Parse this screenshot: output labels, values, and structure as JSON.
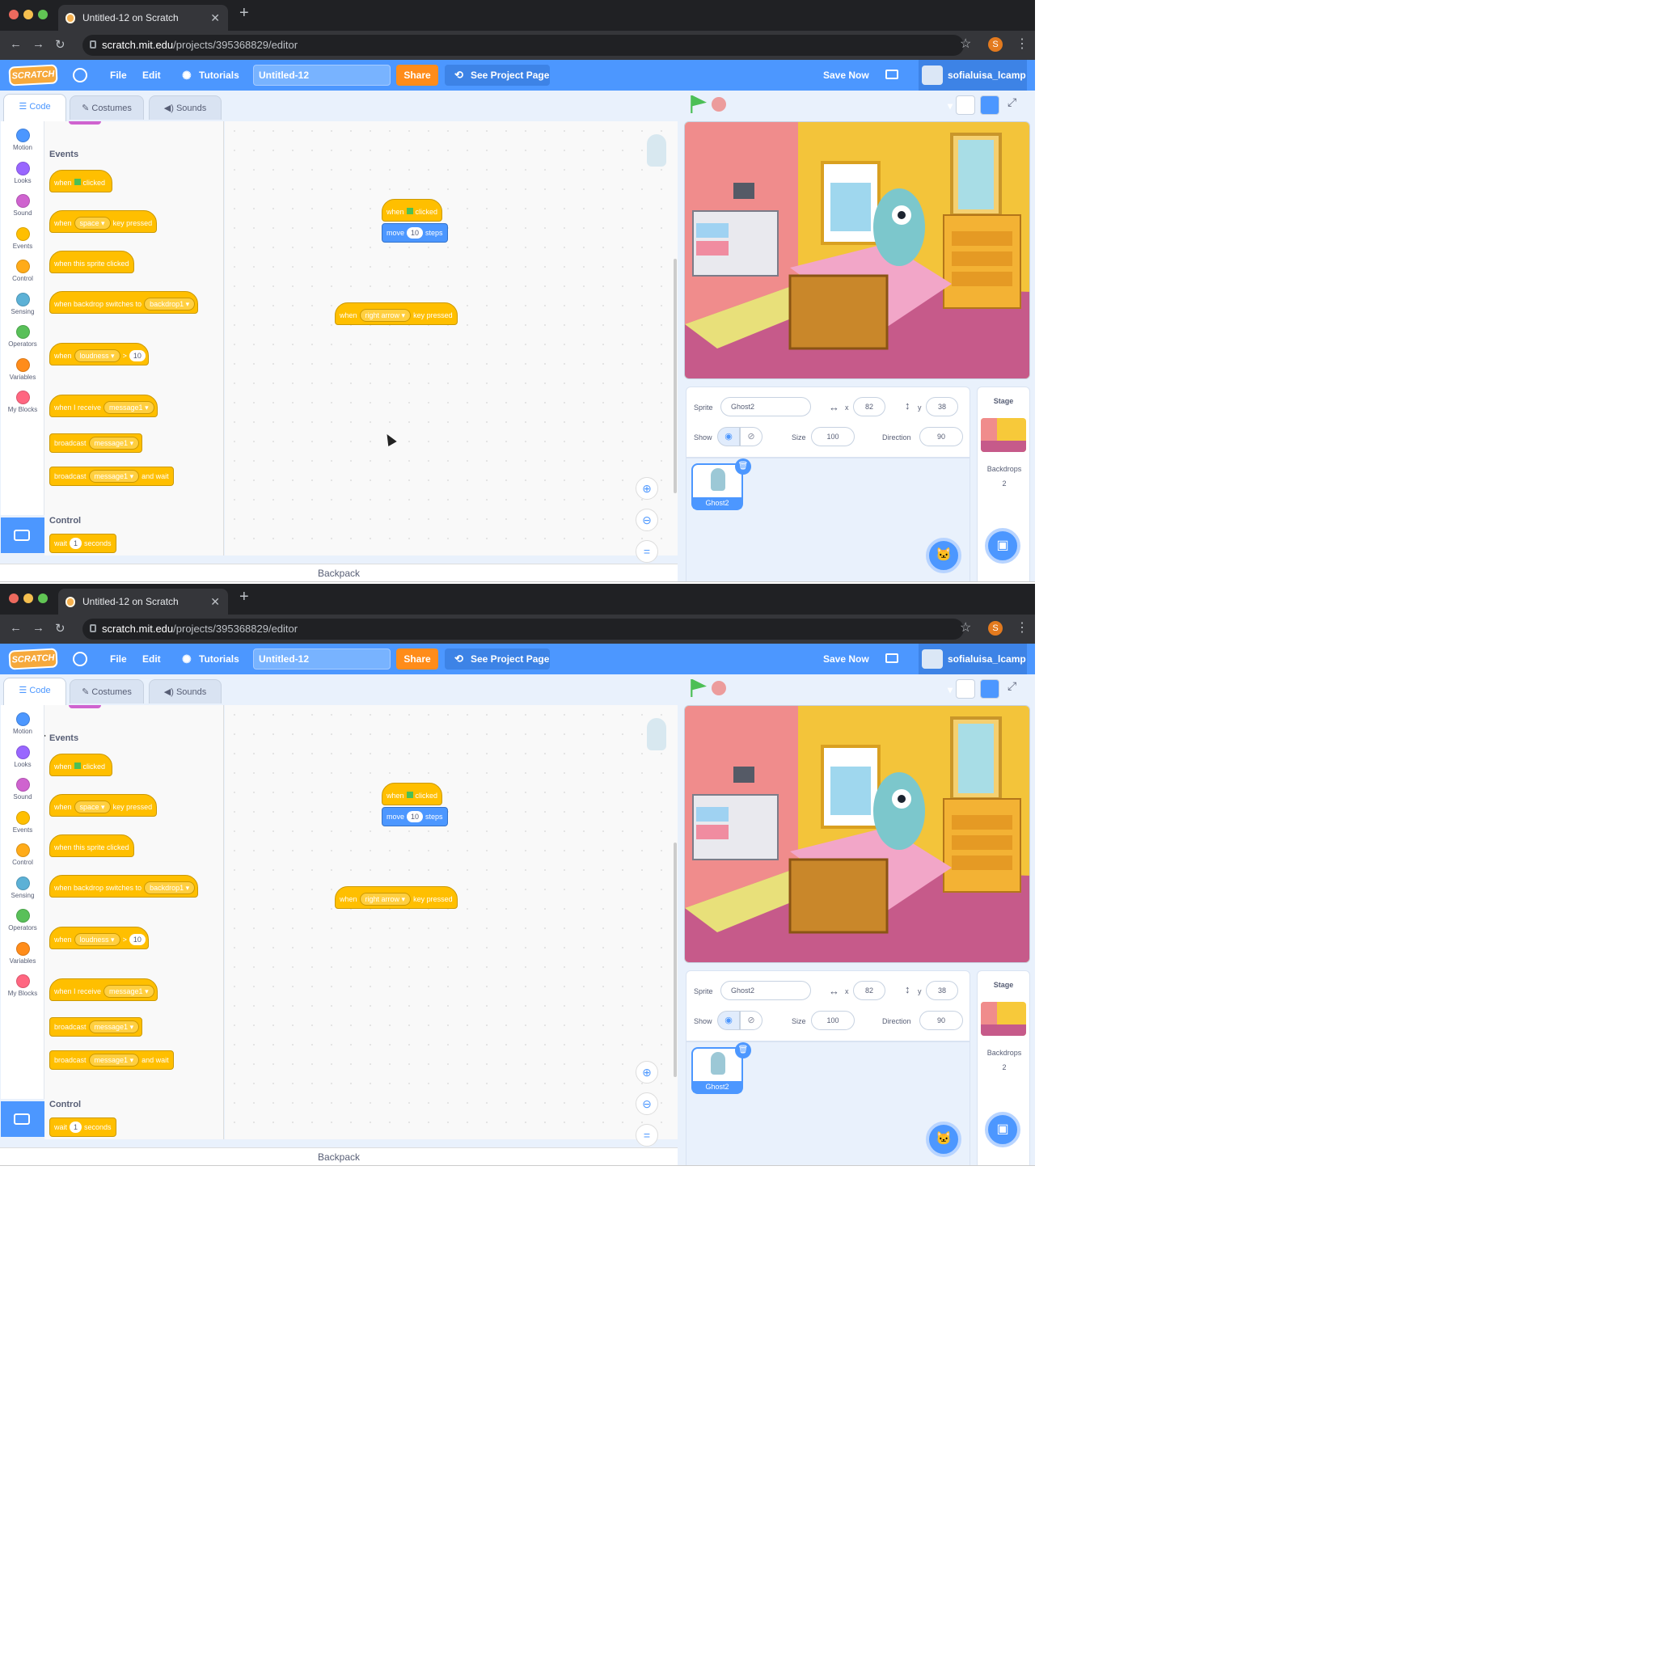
{
  "frames": [
    {
      "browser": {
        "tab_title": "Untitled-12 on Scratch",
        "url_host": "scratch.mit.edu",
        "url_path": "/projects/395368829/editor",
        "profile_initial": "S"
      },
      "menu": {
        "logo": "SCRATCH",
        "file": "File",
        "edit": "Edit",
        "tutorials": "Tutorials",
        "project_title": "Untitled-12",
        "share": "Share",
        "see_project_page": "See Project Page",
        "save_now": "Save Now",
        "username": "sofialuisa_lcamp"
      },
      "tabs": {
        "code": "Code",
        "costumes": "Costumes",
        "sounds": "Sounds"
      },
      "categories": [
        {
          "label": "Motion",
          "color": "#4c97ff"
        },
        {
          "label": "Looks",
          "color": "#9966ff"
        },
        {
          "label": "Sound",
          "color": "#cf63cf"
        },
        {
          "label": "Events",
          "color": "#ffbf00"
        },
        {
          "label": "Control",
          "color": "#ffab19"
        },
        {
          "label": "Sensing",
          "color": "#5cb1d6"
        },
        {
          "label": "Operators",
          "color": "#59c059"
        },
        {
          "label": "Variables",
          "color": "#ff8c1a"
        },
        {
          "label": "My Blocks",
          "color": "#ff6680"
        }
      ],
      "palette": {
        "events_heading": "Events",
        "b_flag": {
          "when": "when",
          "clicked": "clicked"
        },
        "b_key": {
          "when": "when",
          "key": "space",
          "pressed": "key pressed"
        },
        "b_sprite": "when this sprite clicked",
        "b_backdrop": {
          "text": "when backdrop switches to",
          "value": "backdrop1"
        },
        "b_loud": {
          "when": "when",
          "sensor": "loudness",
          "op": ">",
          "value": "10"
        },
        "b_receive": {
          "text": "when I receive",
          "value": "message1"
        },
        "b_broadcast": {
          "text": "broadcast",
          "value": "message1"
        },
        "b_bwait": {
          "text": "broadcast",
          "value": "message1",
          "suffix": "and wait"
        },
        "control_heading": "Control",
        "b_wait": {
          "text": "wait",
          "value": "1",
          "suffix": "seconds"
        }
      },
      "workspace": {
        "script1": {
          "when": "when",
          "clicked": "clicked",
          "move": "move",
          "steps_value": "10",
          "steps": "steps"
        },
        "script2": {
          "when": "when",
          "key": "right arrow",
          "pressed": "key pressed"
        }
      },
      "backpack": "Backpack",
      "sprite_info": {
        "sprite_label": "Sprite",
        "sprite_name": "Ghost2",
        "x_label": "x",
        "x": "82",
        "y_label": "y",
        "y": "38",
        "show_label": "Show",
        "size_label": "Size",
        "size": "100",
        "direction_label": "Direction",
        "direction": "90"
      },
      "sprites": [
        {
          "name": "Ghost2"
        }
      ],
      "stage_pane": {
        "title": "Stage",
        "backdrops_label": "Backdrops",
        "backdrops_count": "2"
      }
    }
  ]
}
